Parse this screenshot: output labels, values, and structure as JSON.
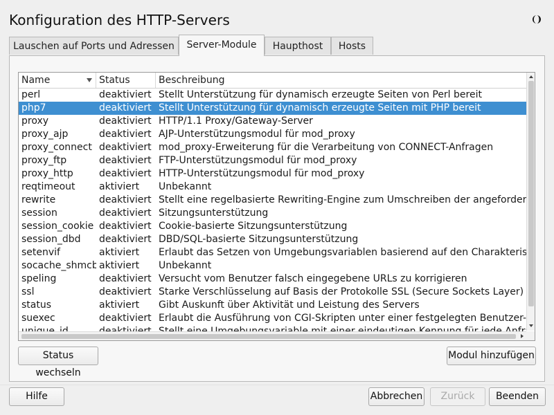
{
  "window": {
    "title": "Konfiguration des HTTP-Servers",
    "theme_icon": "half-moon-icon"
  },
  "tabs": [
    {
      "label": "Lauschen auf Ports und Adressen",
      "active": false
    },
    {
      "label": "Server-Module",
      "active": true
    },
    {
      "label": "Haupthost",
      "active": false
    },
    {
      "label": "Hosts",
      "active": false
    }
  ],
  "table": {
    "columns": [
      "Name",
      "Status",
      "Beschreibung"
    ],
    "sort_column": "Name",
    "selected_row": "php7",
    "rows": [
      {
        "name": "perl",
        "status": "deaktiviert",
        "desc": "Stellt Unterstützung für dynamisch erzeugte Seiten von Perl bereit"
      },
      {
        "name": "php7",
        "status": "deaktiviert",
        "desc": "Stellt Unterstützung für dynamisch erzeugte Seiten mit PHP bereit"
      },
      {
        "name": "proxy",
        "status": "deaktiviert",
        "desc": "HTTP/1.1 Proxy/Gateway-Server"
      },
      {
        "name": "proxy_ajp",
        "status": "deaktiviert",
        "desc": "AJP-Unterstützungsmodul für mod_proxy"
      },
      {
        "name": "proxy_connect",
        "status": "deaktiviert",
        "desc": "mod_proxy-Erweiterung für die Verarbeitung von CONNECT-Anfragen"
      },
      {
        "name": "proxy_ftp",
        "status": "deaktiviert",
        "desc": "FTP-Unterstützungsmodul für mod_proxy"
      },
      {
        "name": "proxy_http",
        "status": "deaktiviert",
        "desc": "HTTP-Unterstützungsmodul für mod_proxy"
      },
      {
        "name": "reqtimeout",
        "status": "aktiviert",
        "desc": "Unbekannt"
      },
      {
        "name": "rewrite",
        "status": "deaktiviert",
        "desc": "Stellt eine regelbasierte Rewriting-Engine zum Umschreiben der angeforderten"
      },
      {
        "name": "session",
        "status": "deaktiviert",
        "desc": "Sitzungsunterstützung"
      },
      {
        "name": "session_cookie",
        "status": "deaktiviert",
        "desc": "Cookie-basierte Sitzungsunterstützung"
      },
      {
        "name": "session_dbd",
        "status": "deaktiviert",
        "desc": "DBD/SQL-basierte Sitzungsunterstützung"
      },
      {
        "name": "setenvif",
        "status": "aktiviert",
        "desc": "Erlaubt das Setzen von Umgebungsvariablen basierend auf den Charakteristiken"
      },
      {
        "name": "socache_shmcb",
        "status": "aktiviert",
        "desc": "Unbekannt"
      },
      {
        "name": "speling",
        "status": "deaktiviert",
        "desc": "Versucht vom Benutzer falsch eingegebene URLs zu korrigieren"
      },
      {
        "name": "ssl",
        "status": "deaktiviert",
        "desc": "Starke Verschlüsselung auf Basis der Protokolle SSL (Secure Sockets Layer) und T"
      },
      {
        "name": "status",
        "status": "aktiviert",
        "desc": "Gibt Auskunft über Aktivität und Leistung des Servers"
      },
      {
        "name": "suexec",
        "status": "deaktiviert",
        "desc": "Erlaubt die Ausführung von CGI-Skripten unter einer festgelegten Benutzer- ode"
      },
      {
        "name": "unique_id",
        "status": "deaktiviert",
        "desc": "Stellt eine Umgebungsvariable mit einer eindeutigen Kennung für jede Anfrage b"
      }
    ]
  },
  "panel_buttons": {
    "status_toggle": "Status wechseln",
    "add_module": "Modul hinzufügen"
  },
  "footer_buttons": {
    "help": "Hilfe",
    "cancel": "Abbrechen",
    "back": "Zurück",
    "finish": "Beenden"
  },
  "colors": {
    "selection": "#3e8fd1",
    "background": "#efefef"
  }
}
